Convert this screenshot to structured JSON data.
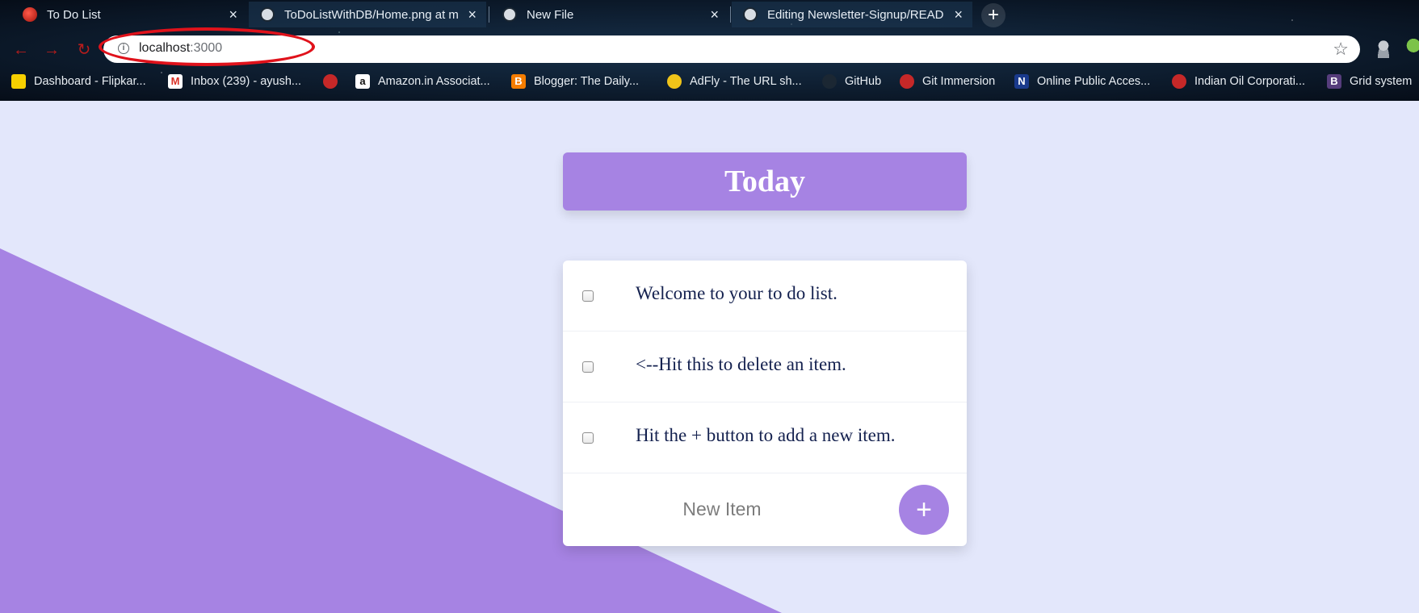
{
  "browser": {
    "tabs": [
      {
        "title": "To Do List",
        "icon": "todo-favicon"
      },
      {
        "title": "ToDoListWithDB/Home.png at m",
        "icon": "github-icon"
      },
      {
        "title": "New File",
        "icon": "github-icon"
      },
      {
        "title": "Editing Newsletter-Signup/READ",
        "icon": "github-icon"
      }
    ],
    "new_tab_label": "+",
    "close_label": "×",
    "address": {
      "host": "localhost",
      "port": ":3000"
    },
    "bookmarks": [
      {
        "label": "Dashboard - Flipkar...",
        "icon": "flipkart-icon",
        "color": "#f7d000"
      },
      {
        "label": "Inbox (239) - ayush...",
        "icon": "gmail-icon",
        "color": "#d93025"
      },
      {
        "label": "",
        "icon": "red-globe-icon",
        "color": "#c62828"
      },
      {
        "label": "Amazon.in Associat...",
        "icon": "amazon-icon",
        "color": "#ffffff"
      },
      {
        "label": "Blogger: The Daily...",
        "icon": "blogger-icon",
        "color": "#f57d00"
      },
      {
        "label": "AdFly - The URL sh...",
        "icon": "adfly-icon",
        "color": "#f0c419"
      },
      {
        "label": "GitHub",
        "icon": "github-icon",
        "color": "#1b2733"
      },
      {
        "label": "Git Immersion",
        "icon": "git-immersion-icon",
        "color": "#c62828"
      },
      {
        "label": "Online Public Acces...",
        "icon": "n-icon",
        "color": "#1a3a8c"
      },
      {
        "label": "Indian Oil Corporati...",
        "icon": "indianoil-icon",
        "color": "#c62828"
      },
      {
        "label": "Grid system",
        "icon": "bootstrap-icon",
        "color": "#563d7c"
      }
    ]
  },
  "page": {
    "heading": "Today",
    "items": [
      "Welcome to your to do list.",
      "<--Hit this to delete an item.",
      "Hit the + button to add a new item."
    ],
    "new_item_placeholder": "New Item",
    "add_button_label": "+",
    "colors": {
      "accent": "#a683e3",
      "background": "#e3e7fb",
      "text": "#14214f",
      "highlight": "#e0121b"
    }
  }
}
